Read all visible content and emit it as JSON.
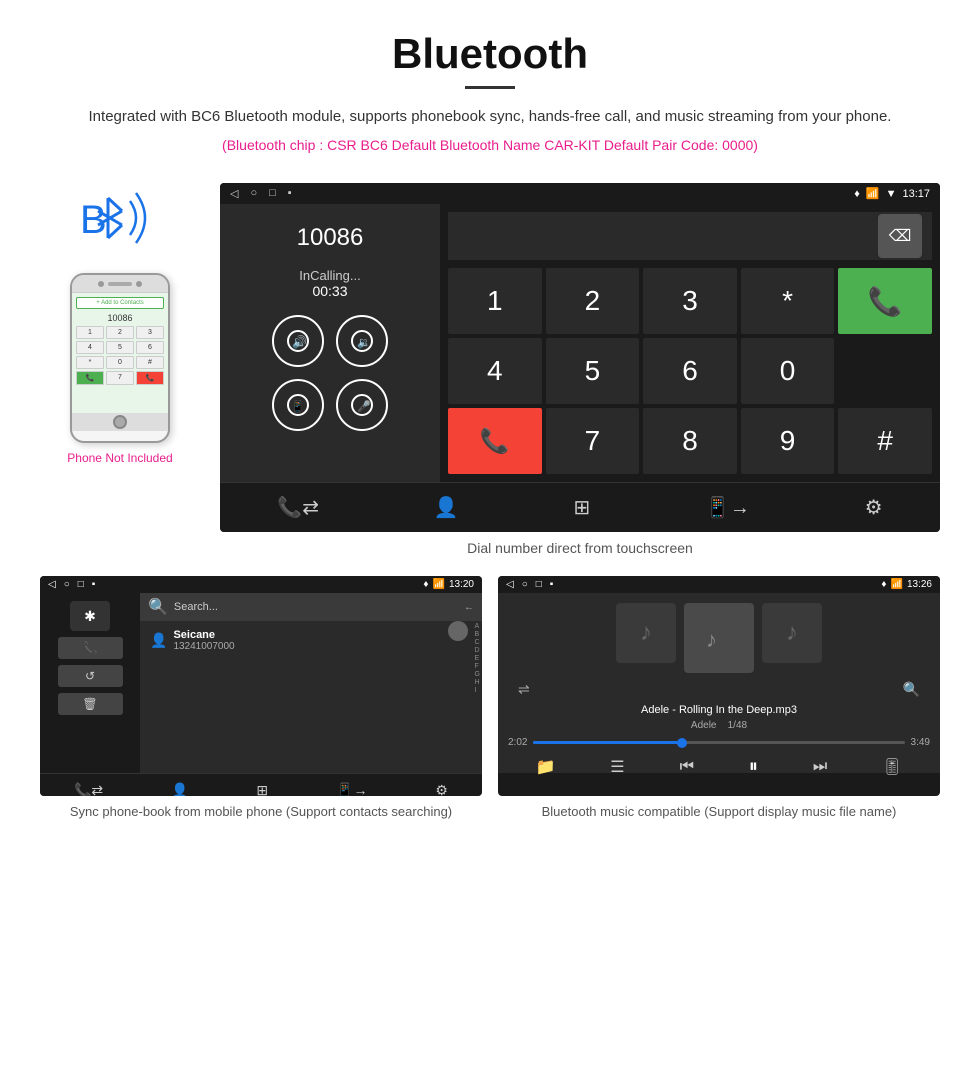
{
  "header": {
    "title": "Bluetooth",
    "description": "Integrated with BC6 Bluetooth module, supports phonebook sync, hands-free call, and music streaming from your phone.",
    "specs": "(Bluetooth chip : CSR BC6    Default Bluetooth Name CAR-KIT    Default Pair Code: 0000)",
    "underline": true
  },
  "phone_section": {
    "not_included_label": "Phone Not Included"
  },
  "car_screen": {
    "status_bar": {
      "back": "◁",
      "home": "○",
      "recent": "□",
      "notification": "▪",
      "location": "♦",
      "phone": "📞",
      "wifi": "▼",
      "time": "13:17"
    },
    "dialer": {
      "number": "10086",
      "status": "InCalling...",
      "timer": "00:33",
      "keys": [
        "1",
        "2",
        "3",
        "*",
        "4",
        "5",
        "6",
        "0",
        "7",
        "8",
        "9",
        "#"
      ]
    },
    "caption": "Dial number direct from touchscreen"
  },
  "phonebook_screen": {
    "status_time": "13:20",
    "contact_name": "Seicane",
    "contact_phone": "13241007000",
    "alphabet": [
      "A",
      "B",
      "C",
      "D",
      "E",
      "F",
      "G",
      "H",
      "I"
    ],
    "caption": "Sync phone-book from mobile phone\n(Support contacts searching)"
  },
  "music_screen": {
    "status_time": "13:26",
    "song_title": "Adele - Rolling In the Deep.mp3",
    "artist": "Adele",
    "track_info": "1/48",
    "time_current": "2:02",
    "time_total": "3:49",
    "progress_percent": 40,
    "caption": "Bluetooth music compatible\n(Support display music file name)"
  },
  "toolbar": {
    "items": [
      "📞",
      "👤",
      "⊞",
      "📱",
      "⚙"
    ]
  }
}
